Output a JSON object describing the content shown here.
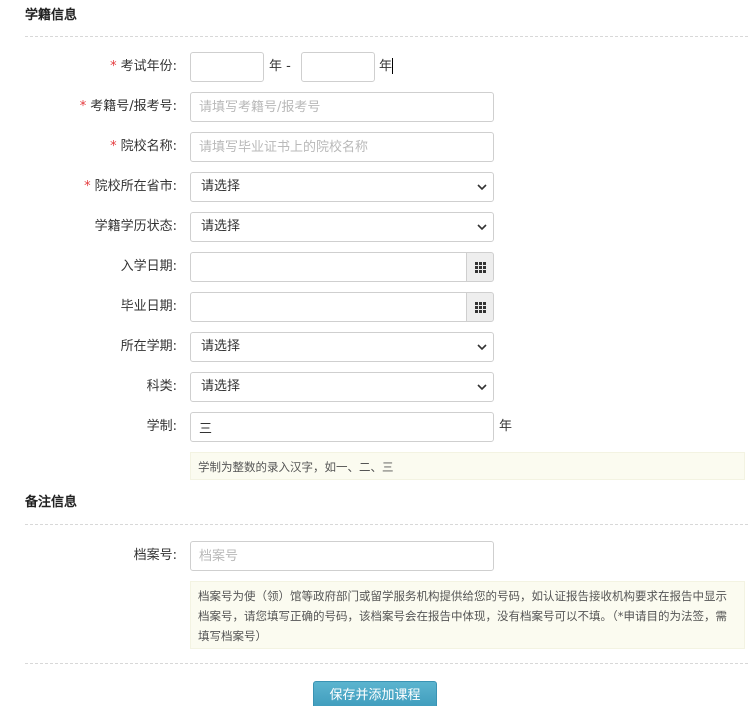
{
  "sections": {
    "student_status": {
      "title": "学籍信息"
    },
    "remarks": {
      "title": "备注信息"
    }
  },
  "fields": {
    "exam_year": {
      "label": "考试年份:",
      "required": "*",
      "from_value": "",
      "to_value": "",
      "year_sep": "年 -",
      "year_suffix": "年"
    },
    "student_id": {
      "label": "考籍号/报考号:",
      "required": "*",
      "placeholder": "请填写考籍号/报考号",
      "value": ""
    },
    "school_name": {
      "label": "院校名称:",
      "required": "*",
      "placeholder": "请填写毕业证书上的院校名称",
      "value": ""
    },
    "school_province": {
      "label": "院校所在省市:",
      "required": "*",
      "selected": "请选择"
    },
    "status_state": {
      "label": "学籍学历状态:",
      "selected": "请选择"
    },
    "enroll_date": {
      "label": "入学日期:",
      "value": ""
    },
    "graduate_date": {
      "label": "毕业日期:",
      "value": ""
    },
    "semester": {
      "label": "所在学期:",
      "selected": "请选择"
    },
    "subject": {
      "label": "科类:",
      "selected": "请选择"
    },
    "duration": {
      "label": "学制:",
      "value": "三",
      "suffix": "年",
      "hint": "学制为整数的录入汉字，如一、二、三"
    },
    "archive_no": {
      "label": "档案号:",
      "placeholder": "档案号",
      "value": "",
      "hint": "档案号为使（领）馆等政府部门或留学服务机构提供给您的号码，如认证报告接收机构要求在报告中显示档案号，请您填写正确的号码，该档案号会在报告中体现，没有档案号可以不填。（*申请目的为法签，需填写档案号）"
    }
  },
  "actions": {
    "save_label": "保存并添加课程"
  },
  "icons": {
    "calendar": "calendar-grid-icon",
    "dropdown": "chevron-down-icon"
  }
}
